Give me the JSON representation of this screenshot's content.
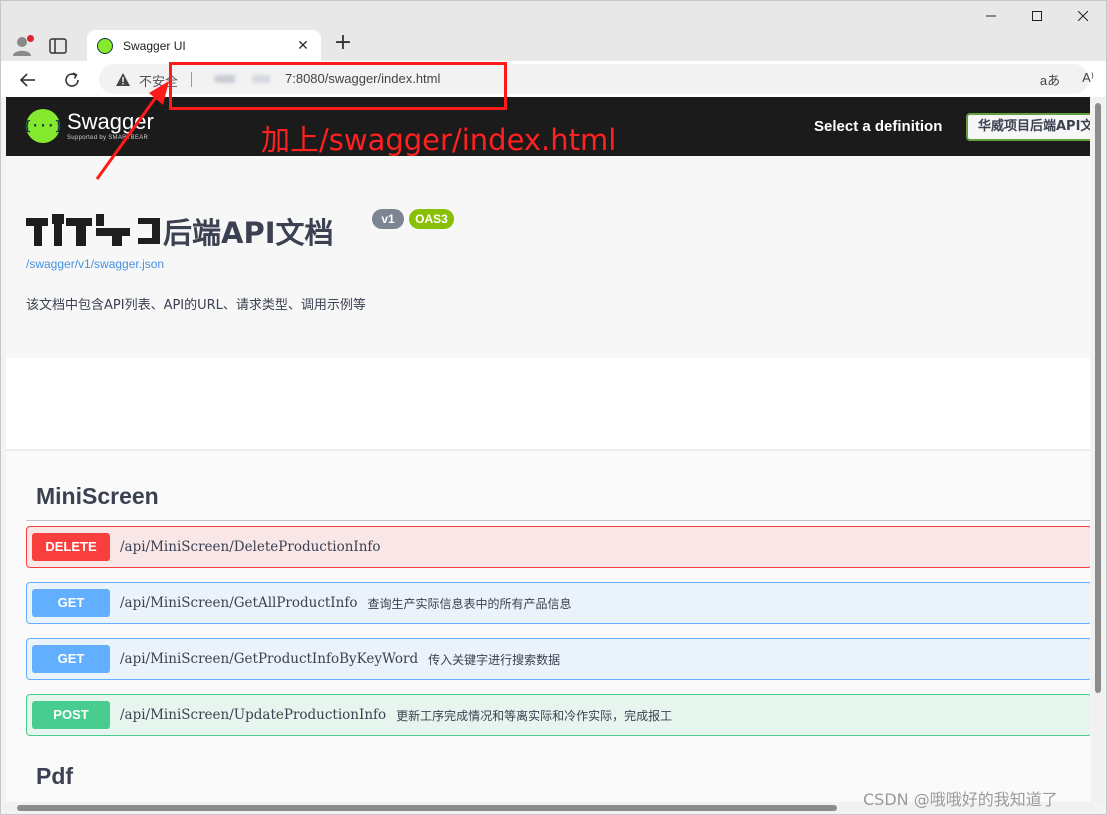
{
  "browser": {
    "tab_title": "Swagger UI",
    "tab_close": "✕",
    "new_tab": "+",
    "insecure_label": "不安全",
    "url_visible": "7:8080/swagger/index.html",
    "read_aloud_label": "aあ",
    "immersive_reader_label": "A⁾"
  },
  "swagger": {
    "brand_name": "Swagger",
    "brand_sub": "Supported by SMARTBEAR",
    "select_definition_label": "Select a definition",
    "definition_value": "华威项目后端API文档",
    "title": "后端API文档",
    "version_badge": "v1",
    "oas_badge": "OAS3",
    "json_link": "/swagger/v1/swagger.json",
    "description": "该文档中包含API列表、API的URL、请求类型、调用示例等",
    "tags": [
      {
        "name": "MiniScreen",
        "operations": [
          {
            "method": "DELETE",
            "path": "/api/MiniScreen/DeleteProductionInfo",
            "summary": ""
          },
          {
            "method": "GET",
            "path": "/api/MiniScreen/GetAllProductInfo",
            "summary": "查询生产实际信息表中的所有产品信息"
          },
          {
            "method": "GET",
            "path": "/api/MiniScreen/GetProductInfoByKeyWord",
            "summary": "传入关键字进行搜索数据"
          },
          {
            "method": "POST",
            "path": "/api/MiniScreen/UpdateProductionInfo",
            "summary": "更新工序完成情况和等离实际和冷作实际，完成报工"
          }
        ]
      },
      {
        "name": "Pdf"
      }
    ]
  },
  "annotation": {
    "text": "加上/swagger/index.html",
    "color": "#ff1a1a"
  },
  "watermark": "CSDN @哦哦好的我知道了",
  "colors": {
    "delete": "#f93e3e",
    "get": "#61affe",
    "post": "#49cc90",
    "swagger_green": "#85ea2d",
    "topbar": "#1b1b1b"
  }
}
